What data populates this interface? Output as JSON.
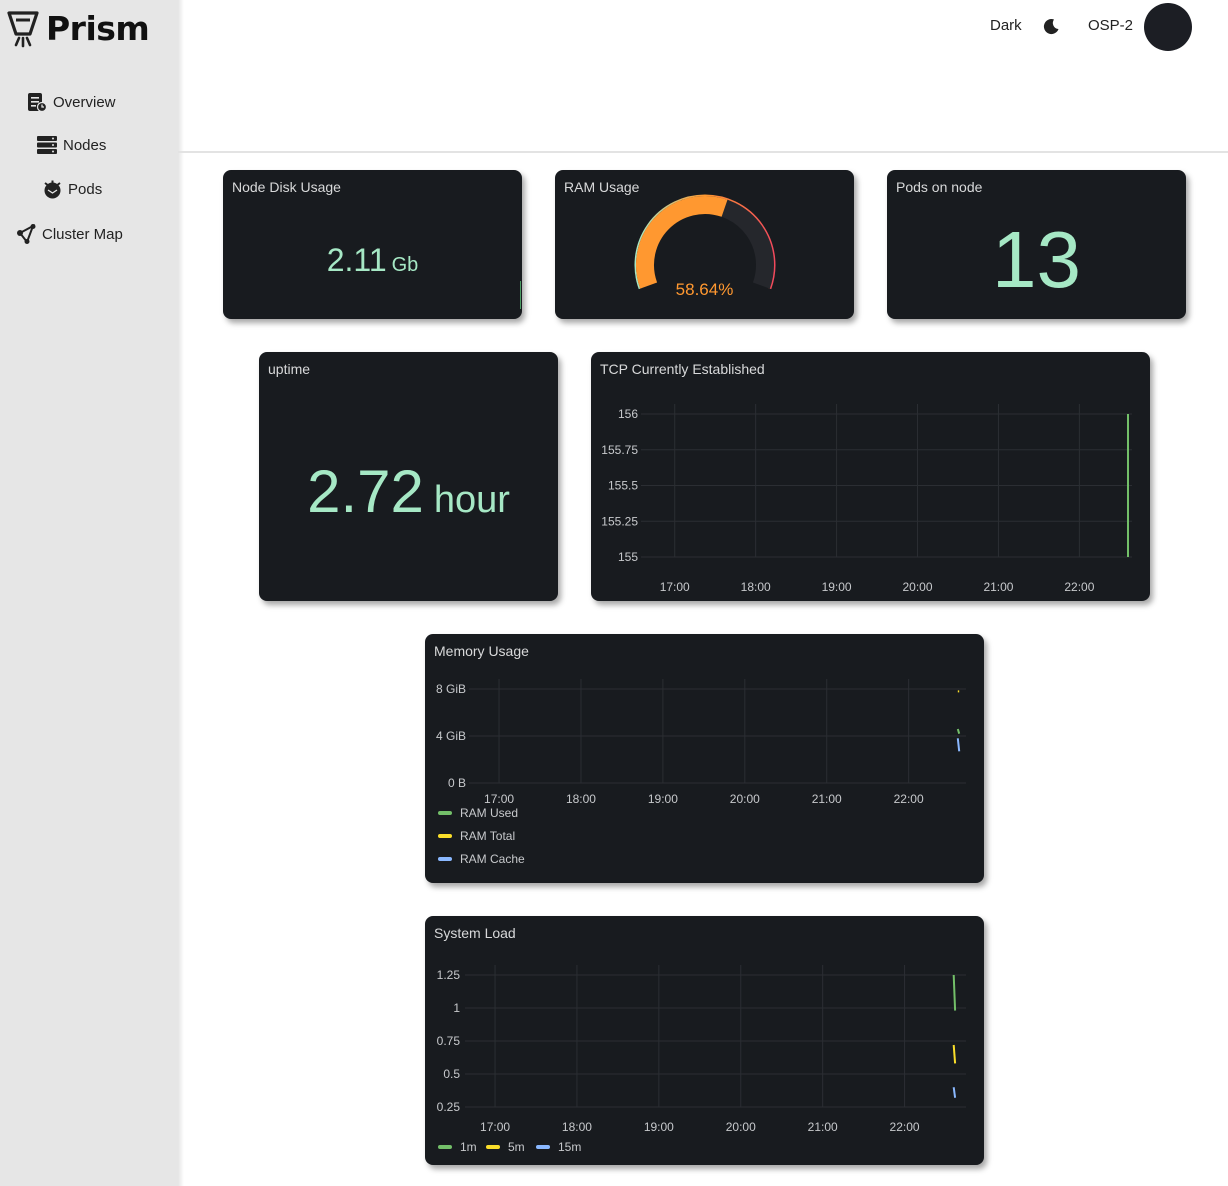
{
  "app": {
    "name": "Prism"
  },
  "sidebar": {
    "items": [
      {
        "label": "Overview",
        "icon": "overview-icon"
      },
      {
        "label": "Nodes",
        "icon": "server-icon"
      },
      {
        "label": "Pods",
        "icon": "pod-icon"
      },
      {
        "label": "Cluster Map",
        "icon": "cluster-map-icon"
      }
    ]
  },
  "header": {
    "theme_label": "Dark",
    "cluster_name": "OSP-2"
  },
  "panels": {
    "disk": {
      "title": "Node Disk Usage",
      "value": "2.11",
      "unit": "Gb"
    },
    "ram": {
      "title": "RAM Usage",
      "value": "58.64%",
      "percent": 58.64
    },
    "pods": {
      "title": "Pods on node",
      "value": "13"
    },
    "uptime": {
      "title": "uptime",
      "value": "2.72",
      "unit": "hour"
    },
    "tcp": {
      "title": "TCP Currently Established"
    },
    "memory": {
      "title": "Memory Usage"
    },
    "load": {
      "title": "System Load"
    }
  },
  "colors": {
    "green": "#73bf69",
    "yellow": "#fade2a",
    "blue": "#8ab8ff",
    "orange": "#ff9830",
    "red": "#f2495c",
    "stat": "#a6e8c5"
  },
  "chart_data": [
    {
      "type": "line",
      "title": "TCP Currently Established",
      "x_ticks": [
        "17:00",
        "18:00",
        "19:00",
        "20:00",
        "21:00",
        "22:00"
      ],
      "y_ticks": [
        "156",
        "155.75",
        "155.5",
        "155.25",
        "155"
      ],
      "ylim": [
        155,
        156
      ],
      "series": [
        {
          "color": "#73bf69",
          "points": [
            {
              "x": "22:36",
              "y": 155
            },
            {
              "x": "22:36",
              "y": 156
            }
          ]
        }
      ]
    },
    {
      "type": "line",
      "title": "Memory Usage",
      "x_ticks": [
        "17:00",
        "18:00",
        "19:00",
        "20:00",
        "21:00",
        "22:00"
      ],
      "y_ticks": [
        "8 GiB",
        "4 GiB",
        "0 B"
      ],
      "ylim": [
        0,
        8
      ],
      "series": [
        {
          "name": "RAM Used",
          "color": "#73bf69",
          "points": [
            {
              "x": "22:36",
              "y": 4.6
            },
            {
              "x": "22:37",
              "y": 4.2
            }
          ]
        },
        {
          "name": "RAM Total",
          "color": "#fade2a",
          "points": [
            {
              "x": "22:36",
              "y": 7.8
            },
            {
              "x": "22:37",
              "y": 7.8
            }
          ]
        },
        {
          "name": "RAM Cache",
          "color": "#8ab8ff",
          "points": [
            {
              "x": "22:36",
              "y": 3.8
            },
            {
              "x": "22:37",
              "y": 2.7
            }
          ]
        }
      ]
    },
    {
      "type": "line",
      "title": "System Load",
      "x_ticks": [
        "17:00",
        "18:00",
        "19:00",
        "20:00",
        "21:00",
        "22:00"
      ],
      "y_ticks": [
        "1.25",
        "1",
        "0.75",
        "0.5",
        "0.25"
      ],
      "ylim": [
        0.25,
        1.25
      ],
      "series": [
        {
          "name": "1m",
          "color": "#73bf69",
          "points": [
            {
              "x": "22:36",
              "y": 1.25
            },
            {
              "x": "22:37",
              "y": 0.98
            }
          ]
        },
        {
          "name": "5m",
          "color": "#fade2a",
          "points": [
            {
              "x": "22:36",
              "y": 0.72
            },
            {
              "x": "22:37",
              "y": 0.58
            }
          ]
        },
        {
          "name": "15m",
          "color": "#8ab8ff",
          "points": [
            {
              "x": "22:36",
              "y": 0.4
            },
            {
              "x": "22:37",
              "y": 0.32
            }
          ]
        }
      ]
    }
  ]
}
